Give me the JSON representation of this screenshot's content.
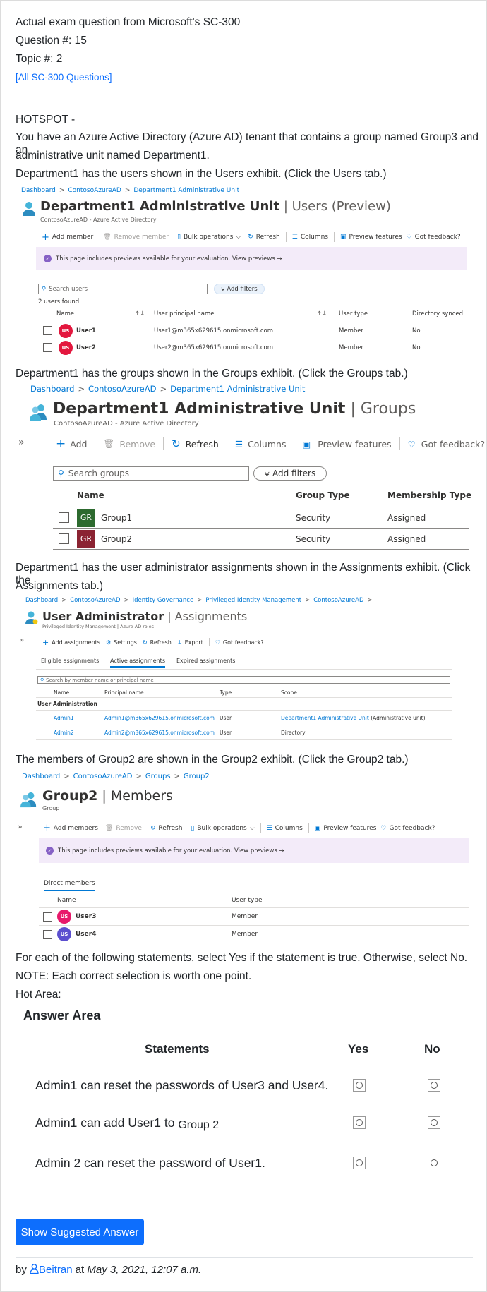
{
  "header": {
    "line1": "Actual exam question from Microsoft's SC-300",
    "line2": "Question #: 15",
    "line3": "Topic #: 2",
    "all_link": "[All SC-300 Questions]"
  },
  "question": {
    "hotspot": "HOTSPOT -",
    "p1a": "You have an Azure Active Directory (Azure AD) tenant that contains a group named Group3 and an",
    "p1b": "administrative unit named Department1.",
    "p2": "Department1 has the users shown in the Users exhibit. (Click the Users tab.)",
    "p3": "Department1 has the groups shown in the Groups exhibit. (Click the Groups tab.)",
    "p4a": "Department1 has the user administrator assignments shown in the Assignments exhibit. (Click the",
    "p4b": "Assignments tab.)",
    "p5": "The members of Group2 are shown in the Group2 exhibit. (Click the Group2 tab.)",
    "p6": "For each of the following statements, select Yes if the statement is true. Otherwise, select No.",
    "p7": "NOTE: Each correct selection is worth one point.",
    "p8": "Hot Area:"
  },
  "users_exhibit": {
    "breadcrumb": [
      "Dashboard",
      "ContosoAzureAD",
      "Department1 Administrative Unit"
    ],
    "title": "Department1 Administrative Unit",
    "title_suffix": "| Users (Preview)",
    "subtitle": "ContosoAzureAD - Azure Active Directory",
    "toolbar": {
      "add_member": "Add member",
      "remove_member": "Remove member",
      "bulk": "Bulk operations",
      "refresh": "Refresh",
      "columns": "Columns",
      "preview": "Preview features",
      "feedback": "Got feedback?"
    },
    "banner": "This page includes previews available for your evaluation. View previews →",
    "search_placeholder": "Search users",
    "add_filters": "Add filters",
    "count": "2 users found",
    "columns": [
      "Name",
      "User principal name",
      "User type",
      "Directory synced"
    ],
    "rows": [
      {
        "initials": "US",
        "name": "User1",
        "upn": "User1@m365x629615.onmicrosoft.com",
        "type": "Member",
        "synced": "No"
      },
      {
        "initials": "US",
        "name": "User2",
        "upn": "User2@m365x629615.onmicrosoft.com",
        "type": "Member",
        "synced": "No"
      }
    ]
  },
  "groups_exhibit": {
    "breadcrumb": [
      "Dashboard",
      "ContosoAzureAD",
      "Department1 Administrative Unit"
    ],
    "title": "Department1 Administrative Unit",
    "title_suffix": "| Groups",
    "subtitle": "ContosoAzureAD - Azure Active Directory",
    "expand": "»",
    "toolbar": {
      "add": "Add",
      "remove": "Remove",
      "refresh": "Refresh",
      "columns": "Columns",
      "preview": "Preview features",
      "feedback": "Got feedback?"
    },
    "search_placeholder": "Search groups",
    "add_filters": "Add filters",
    "columns": [
      "Name",
      "Group Type",
      "Membership Type"
    ],
    "rows": [
      {
        "initials": "GR",
        "name": "Group1",
        "type": "Security",
        "membership": "Assigned",
        "color": "#2d6a2f"
      },
      {
        "initials": "GR",
        "name": "Group2",
        "type": "Security",
        "membership": "Assigned",
        "color": "#8b2332"
      }
    ]
  },
  "assign_exhibit": {
    "breadcrumb": [
      "Dashboard",
      "ContosoAzureAD",
      "Identity Governance",
      "Privileged Identity Management",
      "ContosoAzureAD"
    ],
    "title": "User Administrator",
    "title_suffix": "| Assignments",
    "subtitle": "Privileged Identity Management | Azure AD roles",
    "expand": "»",
    "toolbar": {
      "add": "Add assignments",
      "settings": "Settings",
      "refresh": "Refresh",
      "export": "Export",
      "feedback": "Got feedback?"
    },
    "tabs": [
      "Eligible assignments",
      "Active assignments",
      "Expired assignments"
    ],
    "search_placeholder": "Search by member name or principal name",
    "columns": [
      "Name",
      "Principal name",
      "Type",
      "Scope"
    ],
    "group_label": "User Administration",
    "rows": [
      {
        "name": "Admin1",
        "principal": "Admin1@m365x629615.onmicrosoft.com",
        "type": "User",
        "scope": "Department1 Administrative Unit",
        "scope_suffix": "(Administrative unit)"
      },
      {
        "name": "Admin2",
        "principal": "Admin2@m365x629615.onmicrosoft.com",
        "type": "User",
        "scope": "Directory",
        "scope_suffix": ""
      }
    ]
  },
  "group2_exhibit": {
    "breadcrumb": [
      "Dashboard",
      "ContosoAzureAD",
      "Groups",
      "Group2"
    ],
    "title": "Group2",
    "title_suffix": "| Members",
    "subtitle": "Group",
    "expand": "»",
    "toolbar": {
      "add": "Add members",
      "remove": "Remove",
      "refresh": "Refresh",
      "bulk": "Bulk operations",
      "columns": "Columns",
      "preview": "Preview features",
      "feedback": "Got feedback?"
    },
    "banner": "This page includes previews available for your evaluation. View previews →",
    "tab": "Direct members",
    "columns": [
      "Name",
      "User type"
    ],
    "rows": [
      {
        "initials": "US",
        "name": "User3",
        "type": "Member",
        "color": "#e8196b"
      },
      {
        "initials": "US",
        "name": "User4",
        "type": "Member",
        "color": "#5b4fcf"
      }
    ]
  },
  "answer_area": {
    "title": "Answer Area",
    "col_statements": "Statements",
    "col_yes": "Yes",
    "col_no": "No",
    "s1": "Admin1 can reset the passwords of User3 and User4.",
    "s2a": "Admin1 can add User1 to ",
    "s2b": "Group 2",
    "s3": "Admin 2 can reset the password of User1."
  },
  "footer": {
    "button": "Show Suggested Answer",
    "by": "by",
    "user": "Beitran",
    "at": "at",
    "date": "May 3, 2021, 12:07 a.m."
  },
  "colors": {
    "accent": "#0d6efd",
    "azure_blue": "#0078d4",
    "user_red": "#e3173e"
  }
}
